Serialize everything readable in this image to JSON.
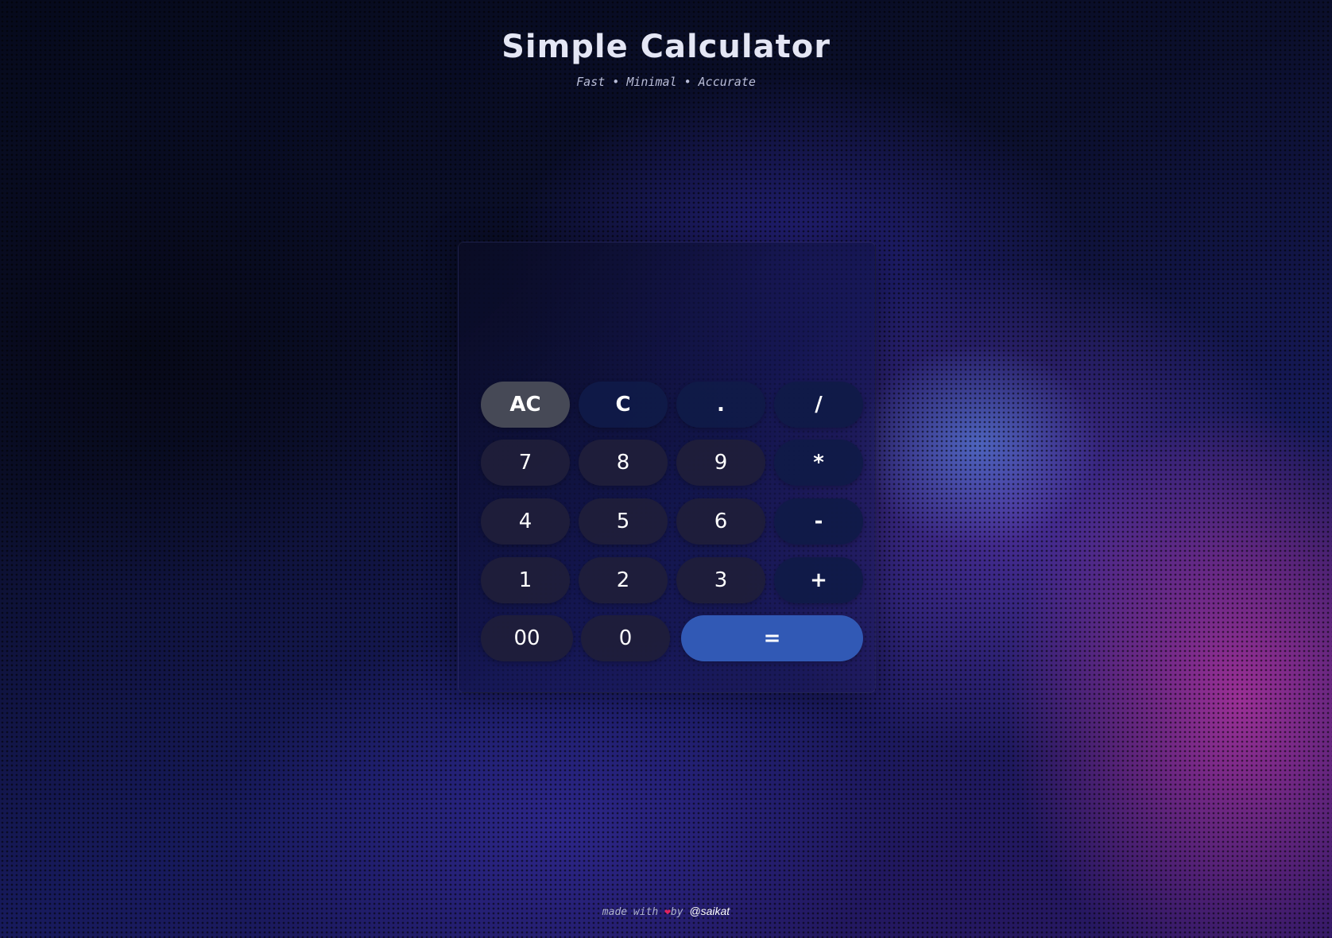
{
  "header": {
    "title": "Simple Calculator",
    "subtitle": "Fast • Minimal • Accurate"
  },
  "display": {
    "value": ""
  },
  "keys": {
    "ac": "AC",
    "clear": "C",
    "dot": ".",
    "divide": "/",
    "seven": "7",
    "eight": "8",
    "nine": "9",
    "multiply": "*",
    "four": "4",
    "five": "5",
    "six": "6",
    "subtract": "-",
    "one": "1",
    "two": "2",
    "three": "3",
    "add": "+",
    "double_zero": "00",
    "zero": "0",
    "equals": "="
  },
  "footer": {
    "made_with": "made with",
    "heart_icon": "heart-icon",
    "by": "by",
    "handle": "@saikat"
  },
  "colors": {
    "equals_button": "#3159b5",
    "ac_button": "#464956",
    "heart": "#e0245e"
  }
}
